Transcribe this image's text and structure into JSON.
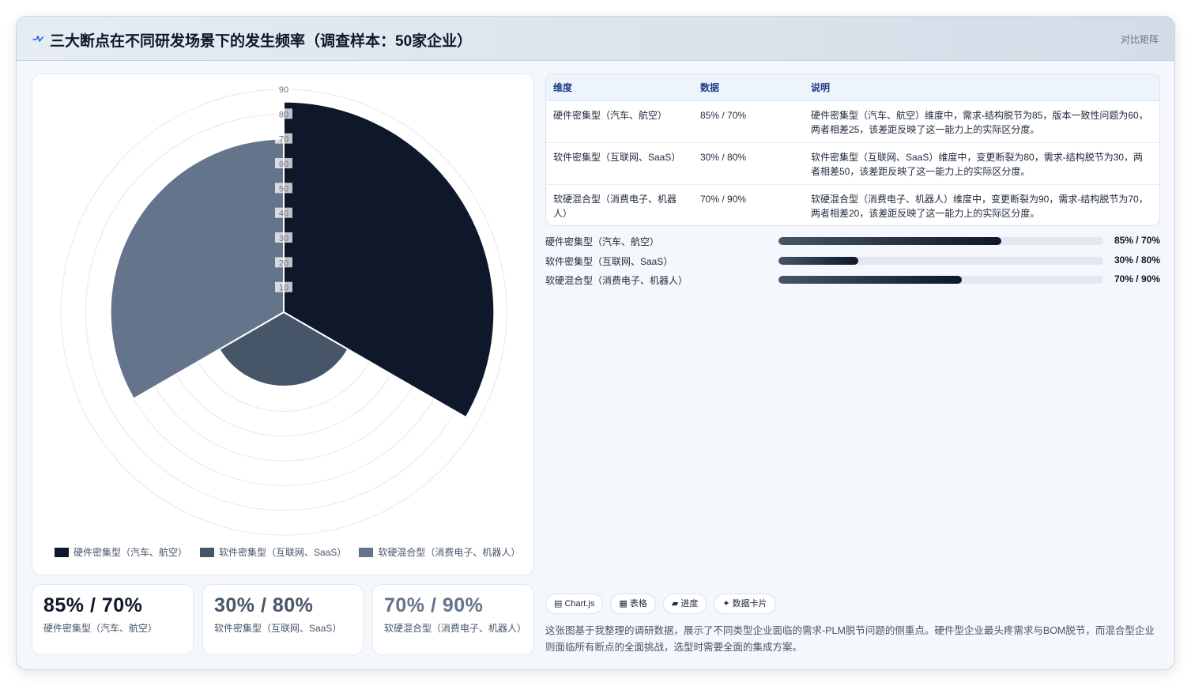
{
  "header": {
    "title": "三大断点在不同研发场景下的发生频率（调查样本：50家企业）",
    "link_label": "对比矩阵",
    "icon": "pulse-icon"
  },
  "chart_data": {
    "type": "polarArea",
    "title": "",
    "categories": [
      "硬件密集型（汽车、航空）",
      "软件密集型（互联网、SaaS）",
      "软硬混合型（消费电子、机器人）"
    ],
    "values": [
      85,
      30,
      70
    ],
    "colors": [
      "#0f172a",
      "#475569",
      "#64748b"
    ],
    "r_range": [
      0,
      90
    ],
    "r_ticks": [
      10,
      20,
      30,
      40,
      50,
      60,
      70,
      80,
      90
    ],
    "grid": true,
    "legend_position": "bottom"
  },
  "stats": [
    {
      "value": "85% / 70%",
      "label": "硬件密集型（汽车、航空）"
    },
    {
      "value": "30% / 80%",
      "label": "软件密集型（互联网、SaaS）"
    },
    {
      "value": "70% / 90%",
      "label": "软硬混合型（消费电子、机器人）"
    }
  ],
  "table": {
    "headers": [
      "维度",
      "数据",
      "说明"
    ],
    "rows": [
      {
        "dim": "硬件密集型（汽车、航空）",
        "data": "85% / 70%",
        "desc": "硬件密集型（汽车、航空）维度中，需求-结构脱节为85，版本一致性问题为60，两者相差25，该差距反映了这一能力上的实际区分度。"
      },
      {
        "dim": "软件密集型（互联网、SaaS）",
        "data": "30% / 80%",
        "desc": "软件密集型（互联网、SaaS）维度中，变更断裂为80，需求-结构脱节为30，两者相差50，该差距反映了这一能力上的实际区分度。"
      },
      {
        "dim": "软硬混合型（消费电子、机器人）",
        "data": "70% / 90%",
        "desc": "软硬混合型（消费电子、机器人）维度中，变更断裂为90，需求-结构脱节为70，两者相差20，该差距反映了这一能力上的实际区分度。"
      }
    ]
  },
  "progress": [
    {
      "label": "硬件密集型（汽车、航空）",
      "value_text": "85% / 70%",
      "fill": 0.685
    },
    {
      "label": "软件密集型（互联网、SaaS）",
      "value_text": "30% / 80%",
      "fill": 0.245
    },
    {
      "label": "软硬混合型（消费电子、机器人）",
      "value_text": "70% / 90%",
      "fill": 0.565
    }
  ],
  "tags": [
    {
      "icon": "chart-icon",
      "glyph": "▤",
      "label": "Chart.js"
    },
    {
      "icon": "table-icon",
      "glyph": "▦",
      "label": "表格"
    },
    {
      "icon": "progress-icon",
      "glyph": "▰",
      "label": "进度"
    },
    {
      "icon": "sparkle-icon",
      "glyph": "✦",
      "label": "数据卡片"
    }
  ],
  "note": "这张图基于我整理的调研数据，展示了不同类型企业面临的需求-PLM脱节问题的侧重点。硬件型企业最头疼需求与BOM脱节，而混合型企业则面临所有断点的全面挑战，选型时需要全面的集成方案。"
}
